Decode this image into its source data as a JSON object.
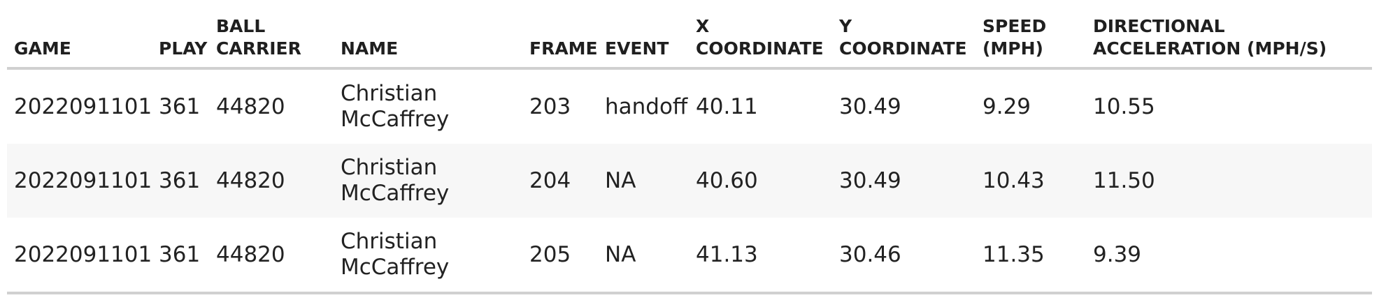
{
  "table": {
    "headers": [
      {
        "key": "game",
        "label": "GAME"
      },
      {
        "key": "play",
        "label": "PLAY"
      },
      {
        "key": "ball_carrier",
        "label": "BALL CARRIER"
      },
      {
        "key": "name",
        "label": "NAME"
      },
      {
        "key": "frame",
        "label": "FRAME"
      },
      {
        "key": "event",
        "label": "EVENT"
      },
      {
        "key": "x",
        "label": "X COORDINATE"
      },
      {
        "key": "y",
        "label": "Y COORDINATE"
      },
      {
        "key": "speed",
        "label": "SPEED (MPH)"
      },
      {
        "key": "accel",
        "label": "DIRECTIONAL ACCELERATION (MPH/S)"
      }
    ],
    "rows": [
      [
        "2022091101",
        "361",
        "44820",
        "Christian McCaffrey",
        "203",
        "handoff",
        "40.11",
        "30.49",
        "9.29",
        "10.55"
      ],
      [
        "2022091101",
        "361",
        "44820",
        "Christian McCaffrey",
        "204",
        "NA",
        "40.60",
        "30.49",
        "10.43",
        "11.50"
      ],
      [
        "2022091101",
        "361",
        "44820",
        "Christian McCaffrey",
        "205",
        "NA",
        "41.13",
        "30.46",
        "11.35",
        "9.39"
      ]
    ]
  },
  "colors": {
    "header_rule": "#d0d0d0",
    "shaded_row": "#f7f7f7",
    "text": "#222222"
  }
}
